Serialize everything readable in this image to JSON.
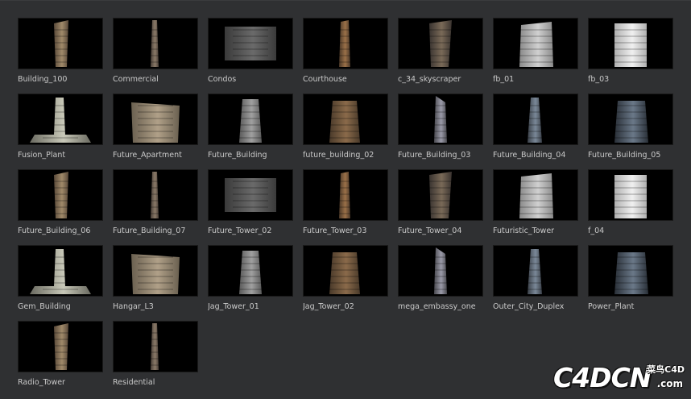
{
  "browser": {
    "items": [
      {
        "label": "Building_100",
        "icon": "building-100-thumbnail"
      },
      {
        "label": "Commercial",
        "icon": "commercial-thumbnail"
      },
      {
        "label": "Condos",
        "icon": "condos-thumbnail"
      },
      {
        "label": "Courthouse",
        "icon": "courthouse-thumbnail"
      },
      {
        "label": "c_34_skyscraper",
        "icon": "skyscraper-thumbnail"
      },
      {
        "label": "fb_01",
        "icon": "fb-01-thumbnail"
      },
      {
        "label": "fb_03",
        "icon": "fb-03-thumbnail"
      },
      {
        "label": "Fusion_Plant",
        "icon": "fusion-plant-thumbnail"
      },
      {
        "label": "Future_Apartment",
        "icon": "future-apartment-thumbnail"
      },
      {
        "label": "Future_Building",
        "icon": "future-building-thumbnail"
      },
      {
        "label": "future_building_02",
        "icon": "future-building-02-thumbnail"
      },
      {
        "label": "Future_Building_03",
        "icon": "future-building-03-thumbnail"
      },
      {
        "label": "Future_Building_04",
        "icon": "future-building-04-thumbnail"
      },
      {
        "label": "Future_Building_05",
        "icon": "future-building-05-thumbnail"
      },
      {
        "label": "Future_Building_06",
        "icon": "future-building-06-thumbnail"
      },
      {
        "label": "Future_Building_07",
        "icon": "future-building-07-thumbnail"
      },
      {
        "label": "Future_Tower_02",
        "icon": "future-tower-02-thumbnail"
      },
      {
        "label": "Future_Tower_03",
        "icon": "future-tower-03-thumbnail"
      },
      {
        "label": "Future_Tower_04",
        "icon": "future-tower-04-thumbnail"
      },
      {
        "label": "Futuristic_Tower",
        "icon": "futuristic-tower-thumbnail"
      },
      {
        "label": "f_04",
        "icon": "f-04-thumbnail"
      },
      {
        "label": "Gem_Building",
        "icon": "gem-building-thumbnail"
      },
      {
        "label": "Hangar_L3",
        "icon": "hangar-thumbnail"
      },
      {
        "label": "Jag_Tower_01",
        "icon": "jag-tower-01-thumbnail"
      },
      {
        "label": "Jag_Tower_02",
        "icon": "jag-tower-02-thumbnail"
      },
      {
        "label": "mega_embassy_one",
        "icon": "mega-embassy-thumbnail"
      },
      {
        "label": "Outer_City_Duplex",
        "icon": "outer-city-duplex-thumbnail"
      },
      {
        "label": "Power_Plant",
        "icon": "power-plant-thumbnail"
      },
      {
        "label": "Radio_Tower",
        "icon": "radio-tower-thumbnail"
      },
      {
        "label": "Residential",
        "icon": "residential-thumbnail"
      }
    ]
  },
  "watermark": {
    "logo_text": "C4DCN",
    "cn_text": "菜鸟C4D",
    "domain_text": ".com",
    "logo_icon": "c4dcn-logo-watermark"
  },
  "colors": {
    "background": "#2f3032",
    "thumb_bg": "#000000",
    "label": "#c9c9c9"
  }
}
